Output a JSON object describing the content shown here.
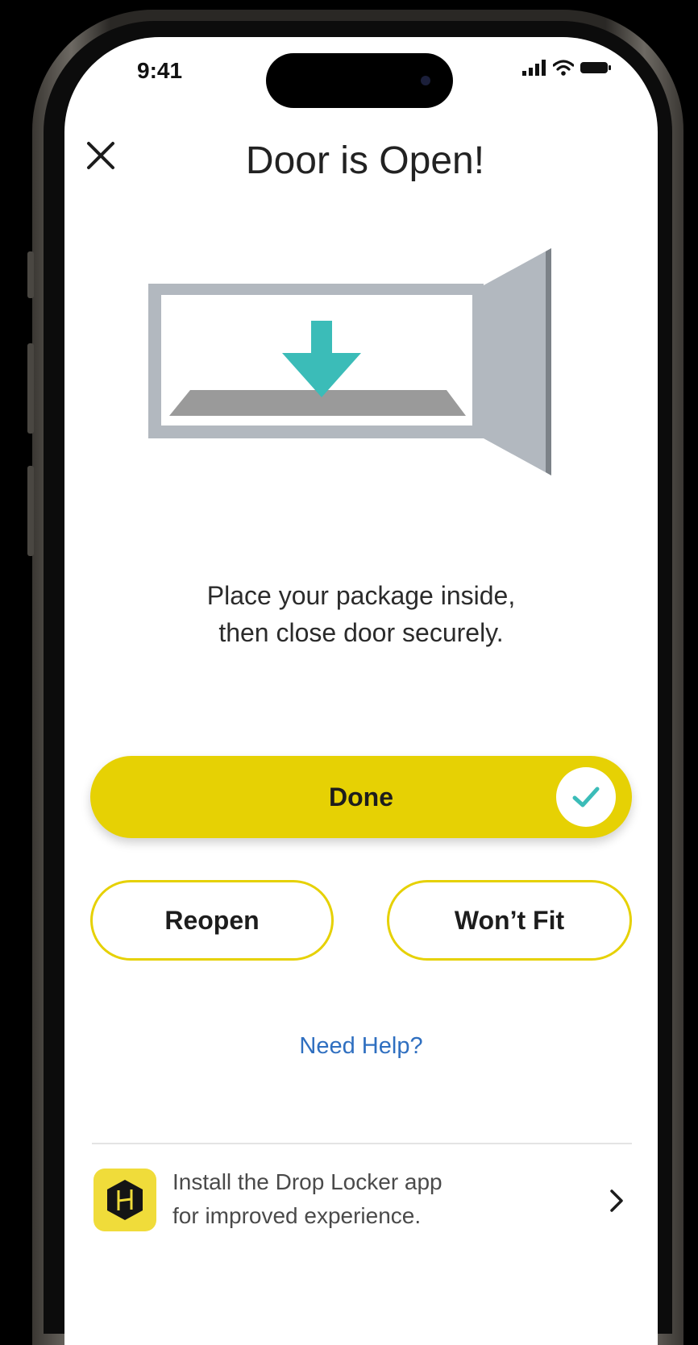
{
  "status_bar": {
    "time": "9:41"
  },
  "header": {
    "title": "Door is Open!"
  },
  "instructions": {
    "line1": "Place your package inside,",
    "line2": "then close door securely."
  },
  "actions": {
    "done_label": "Done",
    "reopen_label": "Reopen",
    "wont_fit_label": "Won’t Fit",
    "help_label": "Need Help?"
  },
  "app_banner": {
    "line1": "Install the Drop Locker app",
    "line2": "for improved experience."
  },
  "colors": {
    "accent_yellow": "#e6d104",
    "arrow_teal": "#3bbcb8",
    "link_blue": "#2f6fc0",
    "locker_gray": "#b2b8bf"
  },
  "icons": {
    "close": "close-icon",
    "done": "checkmark-icon",
    "illustration_arrow": "down-arrow-icon",
    "app_logo": "drop-locker-logo-icon",
    "chevron": "chevron-right-icon"
  }
}
